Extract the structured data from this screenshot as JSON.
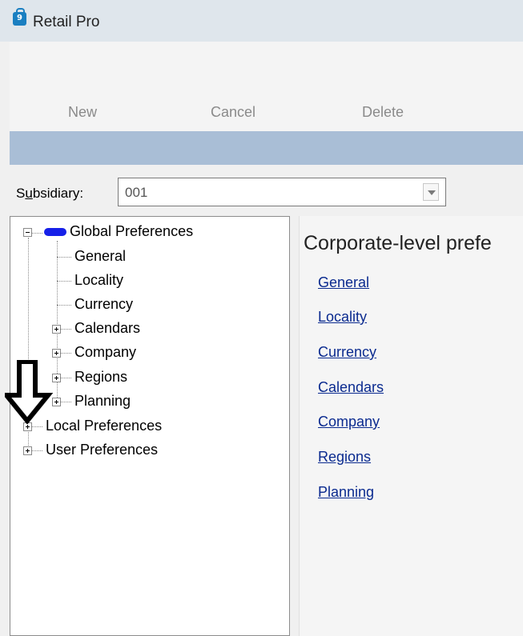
{
  "window": {
    "title": "Retail Pro",
    "icon": "shopping-bag-icon"
  },
  "toolbar": {
    "new_label": "New",
    "cancel_label": "Cancel",
    "delete_label": "Delete"
  },
  "subsidiary": {
    "label_prefix": "S",
    "label_underlined": "u",
    "label_rest": "bsidiary:",
    "value": "001"
  },
  "tree": {
    "global": "Global Preferences",
    "general": "General",
    "locality": "Locality",
    "currency": "Currency",
    "calendars": "Calendars",
    "company": "Company",
    "regions": "Regions",
    "planning": "Planning",
    "local": "Local Preferences",
    "user": "User Preferences"
  },
  "content": {
    "heading": "Corporate-level prefe",
    "links": [
      "General",
      "Locality",
      "Currency",
      "Calendars",
      "Company",
      "Regions",
      "Planning"
    ]
  },
  "colors": {
    "accent_bar": "#a9bed6",
    "link": "#0a2a8f",
    "globe": "#1620e8"
  }
}
